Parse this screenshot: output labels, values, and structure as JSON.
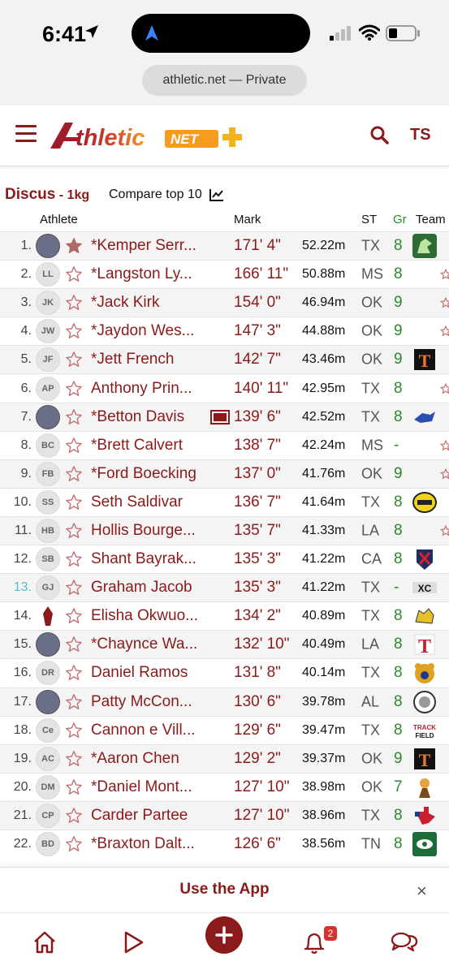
{
  "status_bar": {
    "time": "6:41"
  },
  "browser": {
    "url_text": "athletic.net — Private"
  },
  "header": {
    "user_initials": "TS",
    "brand_color": "#8b1a1a"
  },
  "event": {
    "name": "Discus",
    "sub": "- 1kg",
    "compare_label": "Compare top 10"
  },
  "table": {
    "columns": {
      "athlete": "Athlete",
      "mark": "Mark",
      "state": "ST",
      "grade": "Gr",
      "team": "Team"
    },
    "rows": [
      {
        "rank": "1.",
        "avatar": "",
        "photo": true,
        "starred": true,
        "name": "*Kemper Serr...",
        "video": false,
        "mark": "171' 4\"",
        "metric": "52.22m",
        "state": "TX",
        "grade": "8",
        "team_logo": "dragon-logo"
      },
      {
        "rank": "2.",
        "avatar": "LL",
        "photo": false,
        "starred": false,
        "name": "*Langston Ly...",
        "video": false,
        "mark": "166' 11\"",
        "metric": "50.88m",
        "state": "MS",
        "grade": "8",
        "team_logo": ""
      },
      {
        "rank": "3.",
        "avatar": "JK",
        "photo": false,
        "starred": false,
        "name": "*Jack Kirk",
        "video": false,
        "mark": "154' 0\"",
        "metric": "46.94m",
        "state": "OK",
        "grade": "9",
        "team_logo": ""
      },
      {
        "rank": "4.",
        "avatar": "JW",
        "photo": false,
        "starred": false,
        "name": "*Jaydon Wes...",
        "video": false,
        "mark": "147' 3\"",
        "metric": "44.88m",
        "state": "OK",
        "grade": "9",
        "team_logo": ""
      },
      {
        "rank": "5.",
        "avatar": "JF",
        "photo": false,
        "starred": false,
        "name": "*Jett French",
        "video": false,
        "mark": "142' 7\"",
        "metric": "43.46m",
        "state": "OK",
        "grade": "9",
        "team_logo": "tf-logo"
      },
      {
        "rank": "6.",
        "avatar": "AP",
        "photo": false,
        "starred": false,
        "name": "Anthony Prin...",
        "video": false,
        "mark": "140' 11\"",
        "metric": "42.95m",
        "state": "TX",
        "grade": "8",
        "team_logo": ""
      },
      {
        "rank": "7.",
        "avatar": "",
        "photo": true,
        "starred": false,
        "name": "*Betton Davis",
        "video": true,
        "mark": "139' 6\"",
        "metric": "42.52m",
        "state": "TX",
        "grade": "8",
        "team_logo": "mustang-logo"
      },
      {
        "rank": "8.",
        "avatar": "BC",
        "photo": false,
        "starred": false,
        "name": "*Brett Calvert",
        "video": false,
        "mark": "138' 7\"",
        "metric": "42.24m",
        "state": "MS",
        "grade": "-",
        "team_logo": ""
      },
      {
        "rank": "9.",
        "avatar": "FB",
        "photo": false,
        "starred": false,
        "name": "*Ford Boecking",
        "video": false,
        "mark": "137' 0\"",
        "metric": "41.76m",
        "state": "OK",
        "grade": "9",
        "team_logo": ""
      },
      {
        "rank": "10.",
        "avatar": "SS",
        "photo": false,
        "starred": false,
        "name": "Seth Saldivar",
        "video": false,
        "mark": "136' 7\"",
        "metric": "41.64m",
        "state": "TX",
        "grade": "8",
        "team_logo": "track-logo"
      },
      {
        "rank": "11.",
        "avatar": "HB",
        "photo": false,
        "starred": false,
        "name": "Hollis Bourge...",
        "video": false,
        "mark": "135' 7\"",
        "metric": "41.33m",
        "state": "LA",
        "grade": "8",
        "team_logo": ""
      },
      {
        "rank": "12.",
        "avatar": "SB",
        "photo": false,
        "starred": false,
        "name": "Shant Bayrak...",
        "video": false,
        "mark": "135' 3\"",
        "metric": "41.22m",
        "state": "CA",
        "grade": "8",
        "team_logo": "shield-logo"
      },
      {
        "rank": "13.",
        "avatar": "GJ",
        "photo": false,
        "starred": false,
        "name": "Graham Jacob",
        "video": false,
        "mark": "135' 3\"",
        "metric": "41.22m",
        "state": "TX",
        "grade": "-",
        "team_logo": "xc-logo",
        "highlight": true
      },
      {
        "rank": "14.",
        "avatar": "",
        "photo": false,
        "logo": true,
        "starred": false,
        "name": "Elisha Okwuo...",
        "video": false,
        "mark": "134' 2\"",
        "metric": "40.89m",
        "state": "TX",
        "grade": "8",
        "team_logo": "cat-logo"
      },
      {
        "rank": "15.",
        "avatar": "",
        "photo": true,
        "starred": false,
        "name": "*Chaynce Wa...",
        "video": false,
        "mark": "132' 10\"",
        "metric": "40.49m",
        "state": "LA",
        "grade": "8",
        "team_logo": "t-logo"
      },
      {
        "rank": "16.",
        "avatar": "DR",
        "photo": false,
        "starred": false,
        "name": "Daniel Ramos",
        "video": false,
        "mark": "131' 8\"",
        "metric": "40.14m",
        "state": "TX",
        "grade": "8",
        "team_logo": "bear-logo"
      },
      {
        "rank": "17.",
        "avatar": "",
        "photo": true,
        "starred": false,
        "name": "Patty McCon...",
        "video": false,
        "mark": "130' 6\"",
        "metric": "39.78m",
        "state": "AL",
        "grade": "8",
        "team_logo": "round-logo"
      },
      {
        "rank": "18.",
        "avatar": "Ce",
        "photo": false,
        "starred": false,
        "name": "Cannon e Vill...",
        "video": false,
        "mark": "129' 6\"",
        "metric": "39.47m",
        "state": "TX",
        "grade": "8",
        "team_logo": "field-logo"
      },
      {
        "rank": "19.",
        "avatar": "AC",
        "photo": false,
        "starred": false,
        "name": "*Aaron Chen",
        "video": false,
        "mark": "129' 2\"",
        "metric": "39.37m",
        "state": "OK",
        "grade": "9",
        "team_logo": "tf-logo"
      },
      {
        "rank": "20.",
        "avatar": "DM",
        "photo": false,
        "starred": false,
        "name": "*Daniel Mont...",
        "video": false,
        "mark": "127' 10\"",
        "metric": "38.98m",
        "state": "OK",
        "grade": "7",
        "team_logo": "mascot-logo"
      },
      {
        "rank": "21.",
        "avatar": "CP",
        "photo": false,
        "starred": false,
        "name": "Carder Partee",
        "video": false,
        "mark": "127' 10\"",
        "metric": "38.96m",
        "state": "TX",
        "grade": "8",
        "team_logo": "texas-logo"
      },
      {
        "rank": "22.",
        "avatar": "BD",
        "photo": false,
        "starred": false,
        "name": "*Braxton Dalt...",
        "video": false,
        "mark": "126' 6\"",
        "metric": "38.56m",
        "state": "TN",
        "grade": "8",
        "team_logo": "eye-logo"
      }
    ]
  },
  "banner": {
    "text": "Use the App",
    "close": "×"
  },
  "bottom_nav": {
    "notifications_badge": "2"
  }
}
